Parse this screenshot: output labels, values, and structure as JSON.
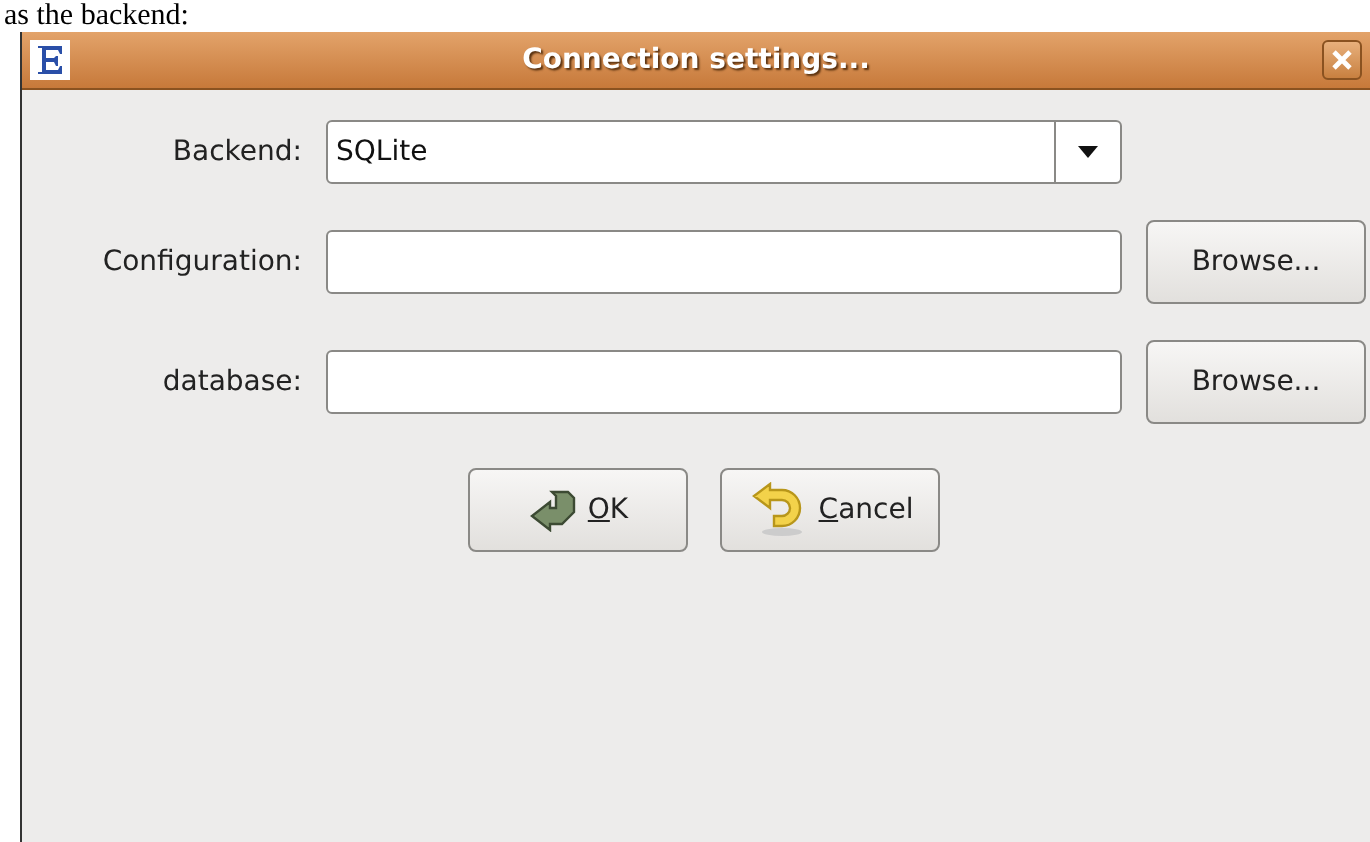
{
  "background_text": "as the backend:",
  "window": {
    "title": "Connection settings..."
  },
  "fields": [
    {
      "kind": "combo",
      "label": "Backend:",
      "value": "SQLite"
    },
    {
      "kind": "file",
      "label": "Configuration:",
      "button": "Browse..."
    },
    {
      "kind": "file",
      "label": "database:",
      "button": "Browse..."
    }
  ],
  "buttons": [
    {
      "kind": "ok",
      "label": "OK",
      "mnemonic": true
    },
    {
      "kind": "cancel",
      "label": "Cancel",
      "mnemonic": true
    }
  ]
}
